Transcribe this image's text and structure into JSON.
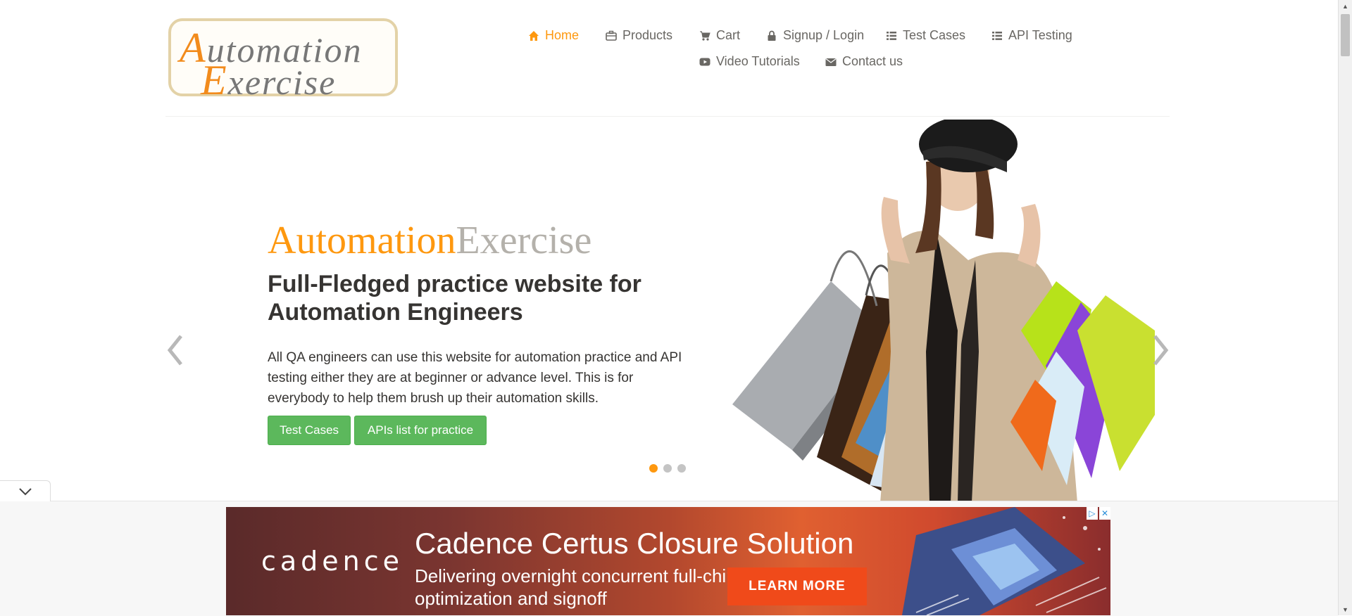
{
  "logo": {
    "line1_cap": "A",
    "line1_rest": "utomation",
    "line2_cap": "E",
    "line2_rest": "xercise"
  },
  "nav": {
    "home": "Home",
    "products": "Products",
    "cart": "Cart",
    "signup": "Signup / Login",
    "test_cases": "Test Cases",
    "api_testing": "API Testing",
    "video": "Video Tutorials",
    "contact": "Contact us"
  },
  "hero": {
    "brand_part1": "Automation",
    "brand_part2": "Exercise",
    "headline": "Full-Fledged practice website for Automation Engineers",
    "description": "All QA engineers can use this website for automation practice and API testing either they are at beginner or advance level. This is for everybody to help them brush up their automation skills.",
    "button_test_cases": "Test Cases",
    "button_apis": "APIs list for practice",
    "active_slide": 1,
    "slide_count": 3
  },
  "ad": {
    "logo": "cadence",
    "title": "Cadence Certus Closure Solution",
    "subtitle": "Delivering overnight concurrent full-chip optimization and signoff",
    "cta": "LEARN MORE",
    "badge_info": "▷",
    "badge_close": "✕"
  },
  "colors": {
    "accent": "#fe980f",
    "button_green": "#5cb85c",
    "text_dark": "#363432"
  }
}
